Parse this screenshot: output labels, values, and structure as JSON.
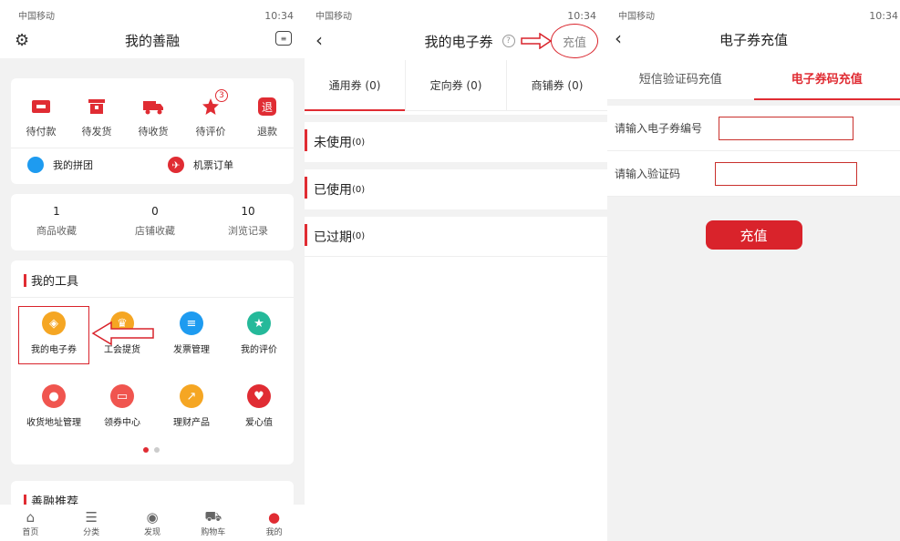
{
  "status": {
    "carrier": "中国移动",
    "time": "10:34"
  },
  "p1": {
    "title": "我的善融",
    "orders": [
      {
        "label": "待付款",
        "icon": "wallet-icon"
      },
      {
        "label": "待发货",
        "icon": "box-icon"
      },
      {
        "label": "待收货",
        "icon": "truck-icon"
      },
      {
        "label": "待评价",
        "icon": "star-icon",
        "badge": "3"
      },
      {
        "label": "退款",
        "icon": "refund-icon",
        "glyph": "退"
      }
    ],
    "groupbuy": "我的拼团",
    "flight": "机票订单",
    "stats": [
      {
        "value": "1",
        "label": "商品收藏"
      },
      {
        "value": "0",
        "label": "店铺收藏"
      },
      {
        "value": "10",
        "label": "浏览记录"
      }
    ],
    "tools_title": "我的工具",
    "tools": [
      {
        "label": "我的电子券",
        "icon": "coupon-tag-icon",
        "color": "#f5a623"
      },
      {
        "label": "工会提货",
        "icon": "union-icon",
        "color": "#f5a623"
      },
      {
        "label": "发票管理",
        "icon": "invoice-icon",
        "color": "#1e9bf0"
      },
      {
        "label": "我的评价",
        "icon": "review-star-icon",
        "color": "#25b99a"
      },
      {
        "label": "收货地址管理",
        "icon": "location-pin-icon",
        "color": "#f0554f"
      },
      {
        "label": "领券中心",
        "icon": "ticket-icon",
        "color": "#f0554f"
      },
      {
        "label": "理财产品",
        "icon": "finance-icon",
        "color": "#f5a623"
      },
      {
        "label": "爱心值",
        "icon": "heart-icon",
        "color": "#e02c33"
      }
    ],
    "recommend_title": "善融推荐",
    "tabbar": [
      {
        "label": "首页",
        "icon": "home-icon"
      },
      {
        "label": "分类",
        "icon": "list-icon"
      },
      {
        "label": "发现",
        "icon": "compass-icon"
      },
      {
        "label": "购物车",
        "icon": "cart-icon"
      },
      {
        "label": "我的",
        "icon": "user-icon"
      }
    ]
  },
  "p2": {
    "title": "我的电子券",
    "recharge": "充值",
    "tabs": [
      "通用券 (0)",
      "定向券 (0)",
      "商铺券 (0)"
    ],
    "categories": [
      {
        "label": "未使用",
        "count": "(0)"
      },
      {
        "label": "已使用",
        "count": "(0)"
      },
      {
        "label": "已过期",
        "count": "(0)"
      }
    ]
  },
  "p3": {
    "title": "电子券充值",
    "tabs": [
      "短信验证码充值",
      "电子券码充值"
    ],
    "field_code": "请输入电子券编号",
    "field_verify": "请输入验证码",
    "button": "充值"
  },
  "colors": {
    "accent": "#e02c33"
  }
}
